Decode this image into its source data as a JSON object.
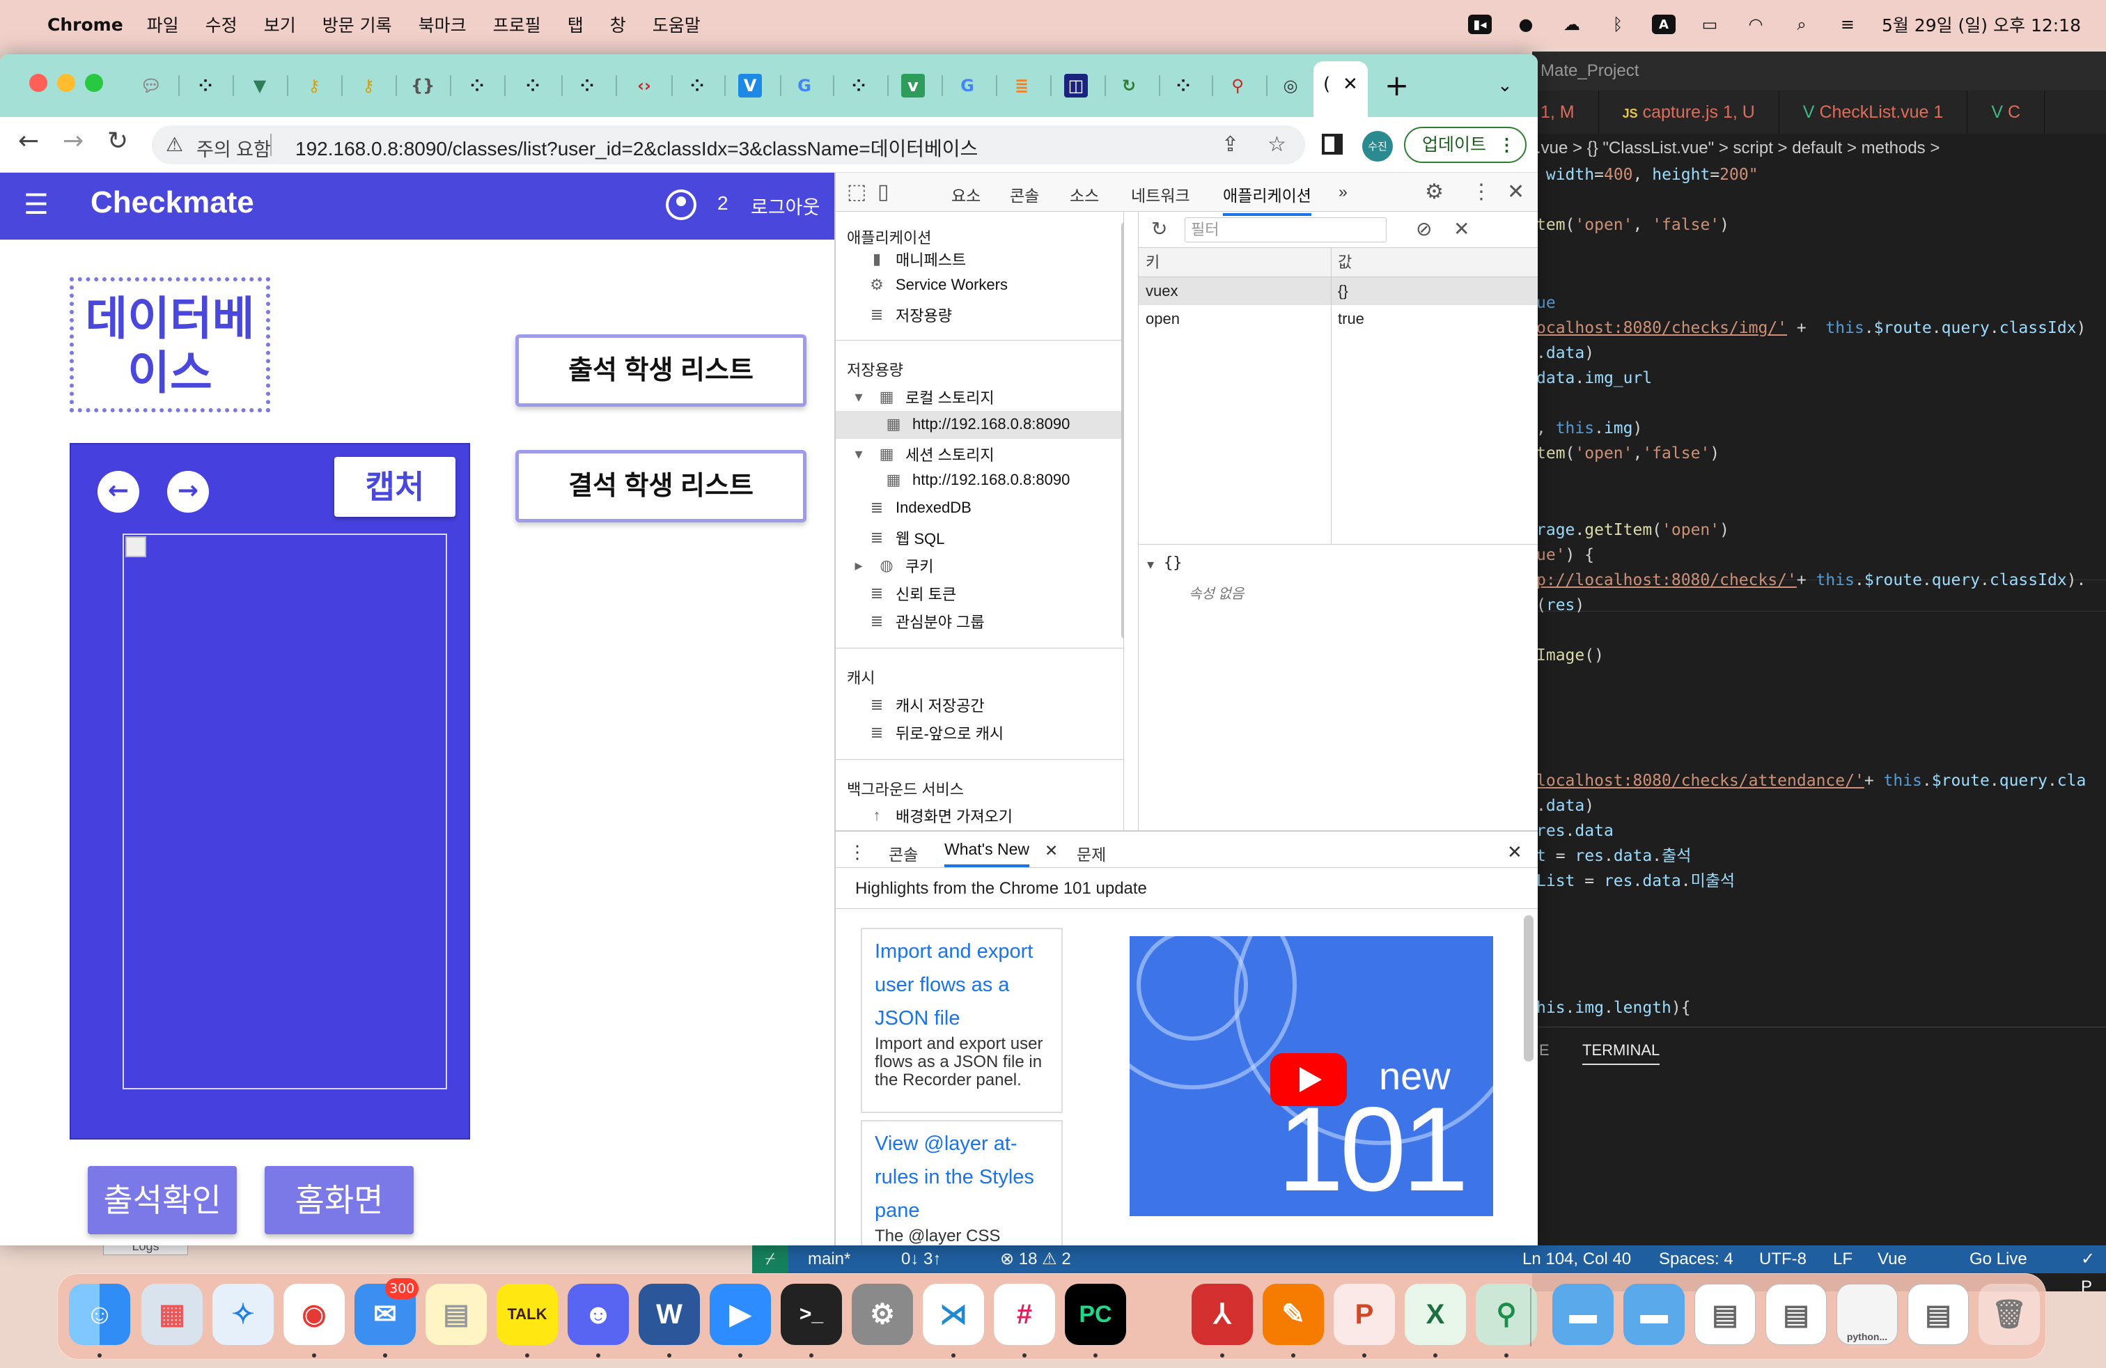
{
  "menubar": {
    "app_name": "Chrome",
    "items": [
      "파일",
      "수정",
      "보기",
      "방문 기록",
      "북마크",
      "프로필",
      "탭",
      "창",
      "도움말"
    ],
    "datetime": "5월 29일 (일) 오후 12:18",
    "status_icons": [
      "zoom-icon",
      "kakao-icon",
      "cloud-icon",
      "bluetooth-icon",
      "input-source-icon",
      "battery-icon",
      "wifi-icon",
      "spotlight-icon",
      "control-center-icon"
    ],
    "input_source_label": "A"
  },
  "vscode": {
    "window_title": "Mate_Project",
    "tabs": [
      {
        "label": "1, M",
        "color": "#e06c5a"
      },
      {
        "label": "capture.js 1, U",
        "icon": "JS",
        "color": "#e06c5a"
      },
      {
        "label": "CheckList.vue 1",
        "color": "#e06c5a"
      },
      {
        "label": "C",
        "color": "#e06c5a"
      }
    ],
    "breadcrumb": ".vue > {} \"ClassList.vue\" > script > default > methods >",
    "terminal_tab": "TERMINAL",
    "panel_tab_partial": "E",
    "status": {
      "branch": "main*",
      "sync": "0↓ 3↑",
      "problems": "⊗ 18 ⚠ 2",
      "position": "Ln 104, Col 40",
      "spaces": "Spaces: 4",
      "encoding": "UTF-8",
      "eol": "LF",
      "language": "Vue",
      "golive": "Go Live",
      "prettier": "✓ P"
    }
  },
  "chrome": {
    "active_tab_label": "(",
    "omnibox": {
      "security_label": "주의 요함",
      "url": "192.168.0.8:8090/classes/list?user_id=2&classIdx=3&className=데이터베이스"
    },
    "profile_label": "수진",
    "update_label": "업데이트"
  },
  "app": {
    "brand": "Checkmate",
    "user_id": "2",
    "logout_label": "로그아웃",
    "class_name": "데이터베이스",
    "attend_list_label": "출석 학생 리스트",
    "absent_list_label": "결석 학생 리스트",
    "capture_label": "캡처",
    "check_label": "출석확인",
    "home_label": "홈화면"
  },
  "devtools": {
    "tabs": [
      "요소",
      "콘솔",
      "소스",
      "네트워크",
      "애플리케이션"
    ],
    "active_tab": "애플리케이션",
    "sidebar": {
      "app_section": "애플리케이션",
      "app_items": [
        "매니페스트",
        "Service Workers",
        "저장용량"
      ],
      "storage_section": "저장용량",
      "local_storage": "로컬 스토리지",
      "local_origin": "http://192.168.0.8:8090",
      "session_storage": "세션 스토리지",
      "session_origin": "http://192.168.0.8:8090",
      "storage_items": [
        "IndexedDB",
        "웹 SQL",
        "쿠키",
        "신뢰 토큰",
        "관심분야 그룹"
      ],
      "cache_section": "캐시",
      "cache_items": [
        "캐시 저장공간",
        "뒤로-앞으로 캐시"
      ],
      "bg_section": "백그라운드 서비스",
      "bg_partial": "배경화면 가져오기"
    },
    "filter_placeholder": "필터",
    "table": {
      "headers": [
        "키",
        "값"
      ],
      "rows": [
        {
          "key": "vuex",
          "value": "{}"
        },
        {
          "key": "open",
          "value": "true"
        }
      ]
    },
    "preview": {
      "root": "{}",
      "empty": "속성 없음"
    },
    "drawer": {
      "tabs": [
        "콘솔",
        "What's New",
        "문제"
      ],
      "headline": "Highlights from the Chrome 101 update",
      "cards": [
        {
          "title": "Import and export user flows as a JSON file",
          "desc": "Import and export user flows as a JSON file in the Recorder panel."
        },
        {
          "title": "View @layer at-rules in the Styles pane",
          "desc": "The @layer CSS Cascade Layers at-rules are now displayed in the"
        }
      ],
      "video_new": "new",
      "video_version": "101"
    }
  },
  "logs_stub": "Logs",
  "dock": {
    "mail_badge": "300",
    "apps": [
      "finder",
      "launchpad",
      "safari",
      "chrome",
      "mail",
      "notes",
      "kakaotalk",
      "discord",
      "word",
      "zoom",
      "terminal",
      "system-settings",
      "vscode",
      "slack",
      "pycharm",
      "acrobat",
      "pen-app",
      "powerpoint",
      "excel",
      "sourcetree",
      "folder",
      "folder",
      "preview",
      "preview",
      "preview",
      "preview",
      "trash"
    ],
    "app_labels": {
      "kakaotalk": "TALK",
      "pycharm": "PC",
      "word": "W",
      "powerpoint": "P",
      "excel": "X",
      "terminal": ">_",
      "slack": "#",
      "thumb": "python..."
    }
  }
}
